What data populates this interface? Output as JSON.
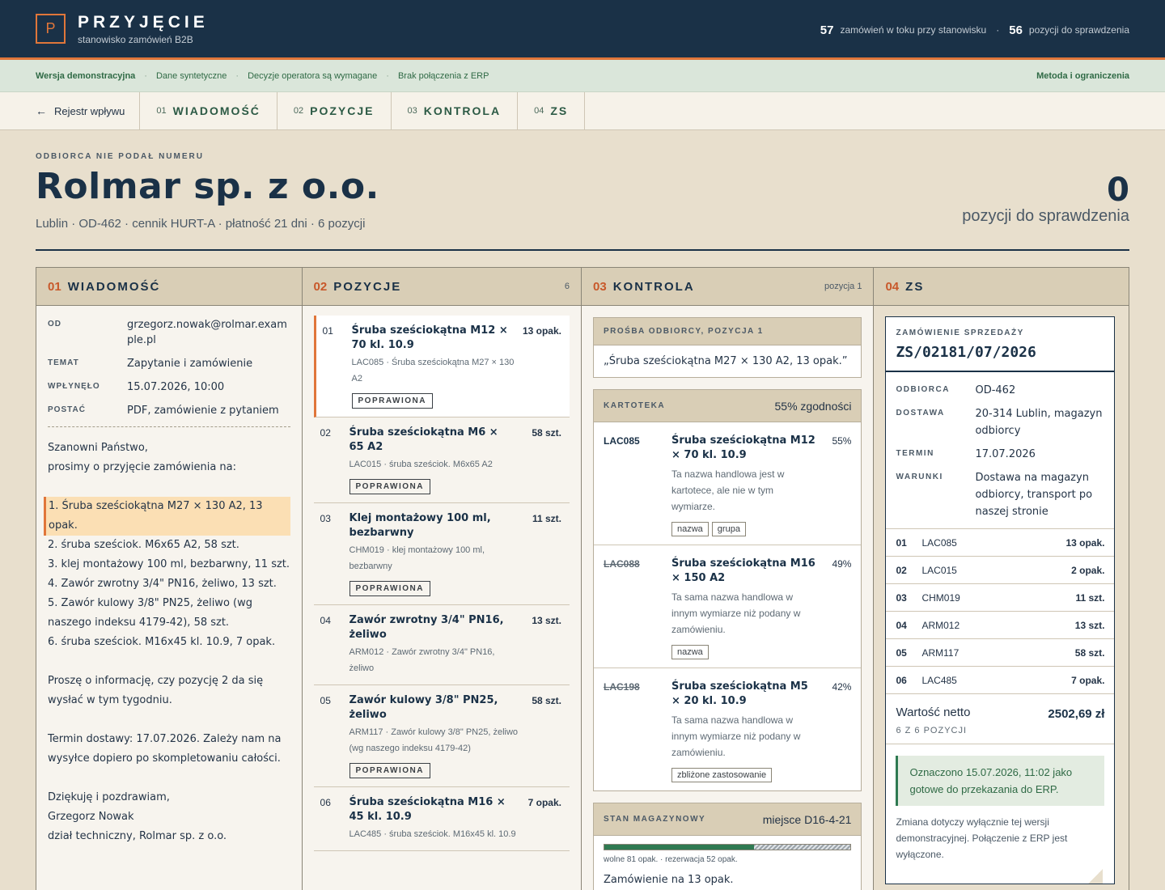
{
  "brand": {
    "logo": "P",
    "title": "PRZYJĘCIE",
    "subtitle": "stanowisko zamówień B2B"
  },
  "top_stats": [
    {
      "value": "57",
      "label": "zamówień w toku przy stanowisku"
    },
    {
      "value": "56",
      "label": "pozycji do sprawdzenia"
    }
  ],
  "demobar": {
    "items": [
      "Wersja demonstracyjna",
      "Dane syntetyczne",
      "Decyzje operatora są wymagane",
      "Brak połączenia z ERP"
    ],
    "method": "Metoda i ograniczenia"
  },
  "steps": {
    "back": "Rejestr wpływu",
    "items": [
      {
        "num": "01",
        "label": "WIADOMOŚĆ"
      },
      {
        "num": "02",
        "label": "POZYCJE"
      },
      {
        "num": "03",
        "label": "KONTROLA"
      },
      {
        "num": "04",
        "label": "ZS"
      }
    ]
  },
  "header": {
    "eyebrow": "ODBIORCA NIE PODAŁ NUMERU",
    "company": "Rolmar sp. z o.o.",
    "meta": "Lublin · OD-462 · cennik HURT-A · płatność 21 dni · 6 pozycji",
    "count": "0",
    "count_label": "pozycji do sprawdzenia"
  },
  "columns": {
    "message": {
      "num": "01",
      "title": "WIADOMOŚĆ"
    },
    "items": {
      "num": "02",
      "title": "POZYCJE",
      "extra": "6"
    },
    "control": {
      "num": "03",
      "title": "KONTROLA",
      "extra": "pozycja 1"
    },
    "zs": {
      "num": "04",
      "title": "ZS"
    }
  },
  "message": {
    "meta": [
      {
        "k": "OD",
        "v": "grzegorz.nowak@rolmar.example.pl"
      },
      {
        "k": "TEMAT",
        "v": "Zapytanie i zamówienie"
      },
      {
        "k": "WPŁYNĘŁO",
        "v": "15.07.2026, 10:00"
      },
      {
        "k": "POSTAĆ",
        "v": "PDF, zamówienie z pytaniem"
      }
    ],
    "body": [
      "Szanowni Państwo,",
      "prosimy o przyjęcie zamówienia na:",
      "",
      "1. Śruba sześciokątna M27 × 130 A2, 13 opak.",
      "2. śruba sześciok. M6x65 A2, 58 szt.",
      "3. klej montażowy 100 ml, bezbarwny, 11 szt.",
      "4. Zawór zwrotny 3/4\" PN16, żeliwo, 13 szt.",
      "5. Zawór kulowy 3/8\" PN25, żeliwo (wg",
      "naszego indeksu 4179-42), 58 szt.",
      "6. śruba sześciok. M16x45 kl. 10.9, 7 opak.",
      "",
      "Proszę o informację, czy pozycję 2 da się",
      "wysłać w tym tygodniu.",
      "",
      "Termin dostawy: 17.07.2026. Zależy nam na",
      "wysyłce dopiero po skompletowaniu całości.",
      "",
      "Dziękuję i pozdrawiam,",
      "Grzegorz Nowak",
      "dział techniczny, Rolmar sp. z o.o."
    ]
  },
  "items": [
    {
      "num": "01",
      "name": "Śruba sześciokątna M12 × 70 kl. 10.9",
      "qty": "13 opak.",
      "sub": "LAC085 · Śruba sześciokątna M27 × 130 A2",
      "badge": "POPRAWIONA"
    },
    {
      "num": "02",
      "name": "Śruba sześciokątna M6 × 65 A2",
      "qty": "58 szt.",
      "sub": "LAC015 · śruba sześciok. M6x65 A2",
      "badge": "POPRAWIONA"
    },
    {
      "num": "03",
      "name": "Klej montażowy 100 ml, bezbarwny",
      "qty": "11 szt.",
      "sub": "CHM019 · klej montażowy 100 ml, bezbarwny",
      "badge": "POPRAWIONA"
    },
    {
      "num": "04",
      "name": "Zawór zwrotny 3/4\" PN16, żeliwo",
      "qty": "13 szt.",
      "sub": "ARM012 · Zawór zwrotny 3/4\" PN16, żeliwo",
      "badge": ""
    },
    {
      "num": "05",
      "name": "Zawór kulowy 3/8\" PN25, żeliwo",
      "qty": "58 szt.",
      "sub": "ARM117 · Zawór kulowy 3/8\" PN25, żeliwo (wg naszego indeksu 4179-42)",
      "badge": "POPRAWIONA"
    },
    {
      "num": "06",
      "name": "Śruba sześciokątna M16 × 45 kl. 10.9",
      "qty": "7 opak.",
      "sub": "LAC485 · śruba sześciok. M16x45 kl. 10.9",
      "badge": ""
    }
  ],
  "control": {
    "request": {
      "title": "PROŚBA ODBIORCY, POZYCJA 1",
      "text": "„Śruba sześciokątna M27 × 130 A2, 13 opak.”"
    },
    "catalog": {
      "title": "KARTOTEKA",
      "match": "55% zgodności",
      "candidates": [
        {
          "code": "LAC085",
          "name": "Śruba sześciokątna M12 × 70 kl. 10.9",
          "pct": "55%",
          "note": "Ta nazwa handlowa jest w kartotece, ale nie w tym wymiarze.",
          "tags": [
            "nazwa",
            "grupa"
          ]
        },
        {
          "code": "LAC088",
          "name": "Śruba sześciokątna M16 × 150 A2",
          "pct": "49%",
          "note": "Ta sama nazwa handlowa w innym wymiarze niż podany w zamówieniu.",
          "tags": [
            "nazwa"
          ]
        },
        {
          "code": "LAC198",
          "name": "Śruba sześciokątna M5 × 20 kl. 10.9",
          "pct": "42%",
          "note": "Ta sama nazwa handlowa w innym wymiarze niż podany w zamówieniu.",
          "tags": [
            "zbliżone zastosowanie"
          ]
        }
      ]
    },
    "stock": {
      "title": "STAN MAGAZYNOWY",
      "location": "miejsce D16-4-21",
      "free": 81,
      "reserved": 52,
      "legend": "wolne 81 opak. · rezerwacja 52 opak.",
      "order": "Zamówienie na 13 opak."
    }
  },
  "zs": {
    "kind": "ZAMÓWIENIE SPRZEDAŻY",
    "number": "ZS/02181/07/2026",
    "meta": [
      {
        "k": "ODBIORCA",
        "v": "OD-462"
      },
      {
        "k": "DOSTAWA",
        "v": "20-314 Lublin, magazyn odbiorcy"
      },
      {
        "k": "TERMIN",
        "v": "17.07.2026"
      },
      {
        "k": "WARUNKI",
        "v": "Dostawa na magazyn odbiorcy, transport po naszej stronie"
      }
    ],
    "lines": [
      {
        "n": "01",
        "code": "LAC085",
        "qty": "13 opak."
      },
      {
        "n": "02",
        "code": "LAC015",
        "qty": "2 opak."
      },
      {
        "n": "03",
        "code": "CHM019",
        "qty": "11 szt."
      },
      {
        "n": "04",
        "code": "ARM012",
        "qty": "13 szt."
      },
      {
        "n": "05",
        "code": "ARM117",
        "qty": "58 szt."
      },
      {
        "n": "06",
        "code": "LAC485",
        "qty": "7 opak."
      }
    ],
    "total_label": "Wartość netto",
    "total_value": "2502,69 zł",
    "total_sub": "6 Z 6 POZYCJI",
    "sent": "Oznaczono 15.07.2026, 11:02 jako gotowe do przekazania do ERP.",
    "note": "Zmiana dotyczy wyłącznie tej wersji demonstracyjnej. Połączenie z ERP jest wyłączone."
  }
}
